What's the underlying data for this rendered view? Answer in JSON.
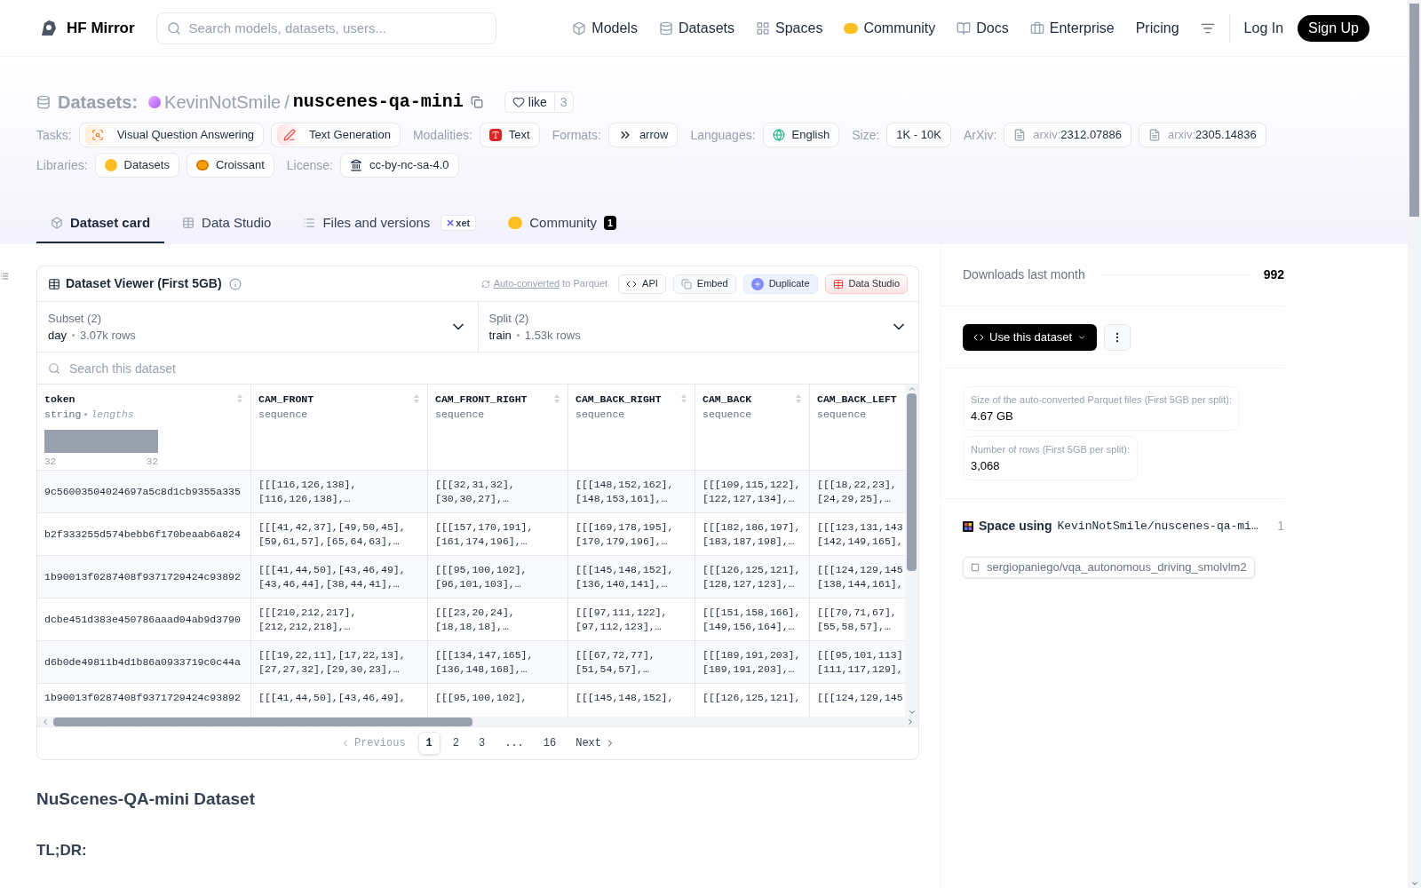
{
  "header": {
    "brand": "HF Mirror",
    "search": {
      "placeholder": "Search models, datasets, users..."
    },
    "nav": [
      {
        "label": "Models",
        "kind": "models"
      },
      {
        "label": "Datasets",
        "kind": "datasets"
      },
      {
        "label": "Spaces",
        "kind": "spaces"
      },
      {
        "label": "Community",
        "kind": "community"
      },
      {
        "label": "Docs",
        "kind": "docs"
      },
      {
        "label": "Enterprise",
        "kind": "enterprise"
      },
      {
        "label": "Pricing",
        "kind": "plain"
      }
    ],
    "login": "Log In",
    "signup": "Sign Up"
  },
  "repo": {
    "section": "Datasets:",
    "owner": "KevinNotSmile",
    "separator": "/",
    "name": "nuscenes-qa-mini",
    "like": "like",
    "likes": "3"
  },
  "tag_rows": [
    [
      {
        "label": "Tasks:",
        "chips": [
          {
            "text": "Visual Question Answering",
            "kind": "vqa"
          },
          {
            "text": "Text Generation",
            "kind": "textgen"
          }
        ]
      },
      {
        "label": "Modalities:",
        "chips": [
          {
            "text": "Text",
            "kind": "text"
          }
        ]
      },
      {
        "label": "Formats:",
        "chips": [
          {
            "text": "arrow",
            "kind": "arrow"
          }
        ]
      },
      {
        "label": "Languages:",
        "chips": [
          {
            "text": "English",
            "kind": "language"
          }
        ]
      },
      {
        "label": "Size:",
        "chips": [
          {
            "text": "1K - 10K",
            "kind": "plain"
          }
        ]
      },
      {
        "label": "ArXiv:",
        "chips": [
          {
            "prefix": "arxiv:",
            "text": "2312.07886",
            "kind": "paper"
          },
          {
            "prefix": "arxiv:",
            "text": "2305.14836",
            "kind": "paper"
          }
        ]
      }
    ],
    [
      {
        "label": "Libraries:",
        "chips": [
          {
            "text": "Datasets",
            "kind": "datasets"
          },
          {
            "text": "Croissant",
            "kind": "croissant"
          }
        ]
      },
      {
        "label": "License:",
        "chips": [
          {
            "text": "cc-by-nc-sa-4.0",
            "kind": "license"
          }
        ]
      }
    ]
  ],
  "tabs": [
    {
      "label": "Dataset card",
      "selected": true,
      "kind": "card"
    },
    {
      "label": "Data Studio",
      "selected": false,
      "kind": "studio"
    },
    {
      "label": "Files and versions",
      "selected": false,
      "kind": "files",
      "badge": "xet"
    },
    {
      "label": "Community",
      "selected": false,
      "kind": "community",
      "count": "1"
    }
  ],
  "viewer": {
    "title": "Dataset Viewer (First 5GB)",
    "converted_link": "Auto-converted",
    "converted_text": "to Parquet",
    "actions": [
      {
        "label": "API",
        "kind": "api"
      },
      {
        "label": "Embed",
        "kind": "embed"
      },
      {
        "label": "Duplicate",
        "kind": "duplicate"
      },
      {
        "label": "Data Studio",
        "kind": "studio"
      }
    ],
    "selectors": [
      {
        "label": "Subset (2)",
        "value": "day",
        "rows": "3.07k rows"
      },
      {
        "label": "Split (2)",
        "value": "train",
        "rows": "1.53k rows"
      }
    ],
    "search": {
      "placeholder": "Search this dataset"
    },
    "columns": [
      {
        "name": "token",
        "type": "string",
        "stat": "lengths",
        "min": "32",
        "max": "32"
      },
      {
        "name": "CAM_FRONT",
        "type": "sequence"
      },
      {
        "name": "CAM_FRONT_RIGHT",
        "type": "sequence"
      },
      {
        "name": "CAM_BACK_RIGHT",
        "type": "sequence"
      },
      {
        "name": "CAM_BACK",
        "type": "sequence"
      },
      {
        "name": "CAM_BACK_LEFT",
        "type": "sequence"
      }
    ],
    "rows": [
      [
        "9c56003504024697a5c8d1cb9355a335",
        "[[[116,126,138],\n[116,126,138],…",
        "[[[32,31,32],\n[30,30,27],…",
        "[[[148,152,162],\n[148,153,161],…",
        "[[[109,115,122],\n[122,127,134],…",
        "[[[18,22,23],\n[24,29,25],…"
      ],
      [
        "b2f333255d574bebb6f170beaab6a824",
        "[[[41,42,37],[49,50,45],\n[59,61,57],[65,64,63],…",
        "[[[157,170,191],\n[161,174,196],…",
        "[[[169,178,195],\n[170,179,196],…",
        "[[[182,186,197],\n[183,187,198],…",
        "[[[123,131,143\n[142,149,165],"
      ],
      [
        "1b90013f0287408f9371729424c93892",
        "[[[41,44,50],[43,46,49],\n[43,46,44],[38,44,41],…",
        "[[[95,100,102],\n[96,101,103],…",
        "[[[145,148,152],\n[136,140,141],…",
        "[[[126,125,121],\n[128,127,123],…",
        "[[[124,129,145\n[138,144,161],"
      ],
      [
        "dcbe451d383e450786aaad04ab9d3790",
        "[[[210,212,217],\n[212,212,218],…",
        "[[[23,20,24],\n[18,18,18],…",
        "[[[97,111,122],\n[97,112,123],…",
        "[[[151,158,166],\n[149,156,164],…",
        "[[[70,71,67],\n[55,58,57],…"
      ],
      [
        "d6b0de49811b4d1b86a0933719c0c44a",
        "[[[19,22,11],[17,22,13],\n[27,27,32],[29,30,23],…",
        "[[[134,147,165],\n[136,148,168],…",
        "[[[67,72,77],\n[51,54,57],…",
        "[[[189,191,203],\n[189,191,203],…",
        "[[[95,101,113]\n[111,117,129],"
      ],
      [
        "1b90013f0287408f9371729424c93892",
        "[[[41,44,50],[43,46,49],",
        "[[[95,100,102],",
        "[[[145,148,152],",
        "[[[126,125,121],",
        "[[[124,129,145"
      ]
    ],
    "pages": [
      {
        "label": "Previous",
        "kind": "prev",
        "disabled": true
      },
      {
        "label": "1",
        "kind": "page",
        "selected": true
      },
      {
        "label": "2",
        "kind": "page",
        "selected": false
      },
      {
        "label": "3",
        "kind": "page",
        "selected": false
      },
      {
        "label": "...",
        "kind": "gap"
      },
      {
        "label": "16",
        "kind": "page",
        "selected": false
      },
      {
        "label": "Next",
        "kind": "next",
        "disabled": false
      }
    ]
  },
  "readme": [
    {
      "kind": "h2",
      "text": "NuScenes-QA-mini Dataset"
    },
    {
      "kind": "h3",
      "text": "TL;DR:"
    }
  ],
  "sidebar": {
    "downloads_label": "Downloads last month",
    "downloads": "992",
    "use_button": "Use this dataset",
    "stats": [
      {
        "label": "Size of the auto-converted Parquet files (First 5GB per split):",
        "value": "4.67 GB"
      },
      {
        "label": "Number of rows (First 5GB per split):",
        "value": "3,068"
      }
    ],
    "spaces_title": "Space using",
    "spaces_repo": "KevinNotSmile/nuscenes-qa-mi…",
    "spaces_count": "1",
    "spaces": [
      "sergiopaniego/vqa_autonomous_driving_smolvlm2"
    ]
  }
}
